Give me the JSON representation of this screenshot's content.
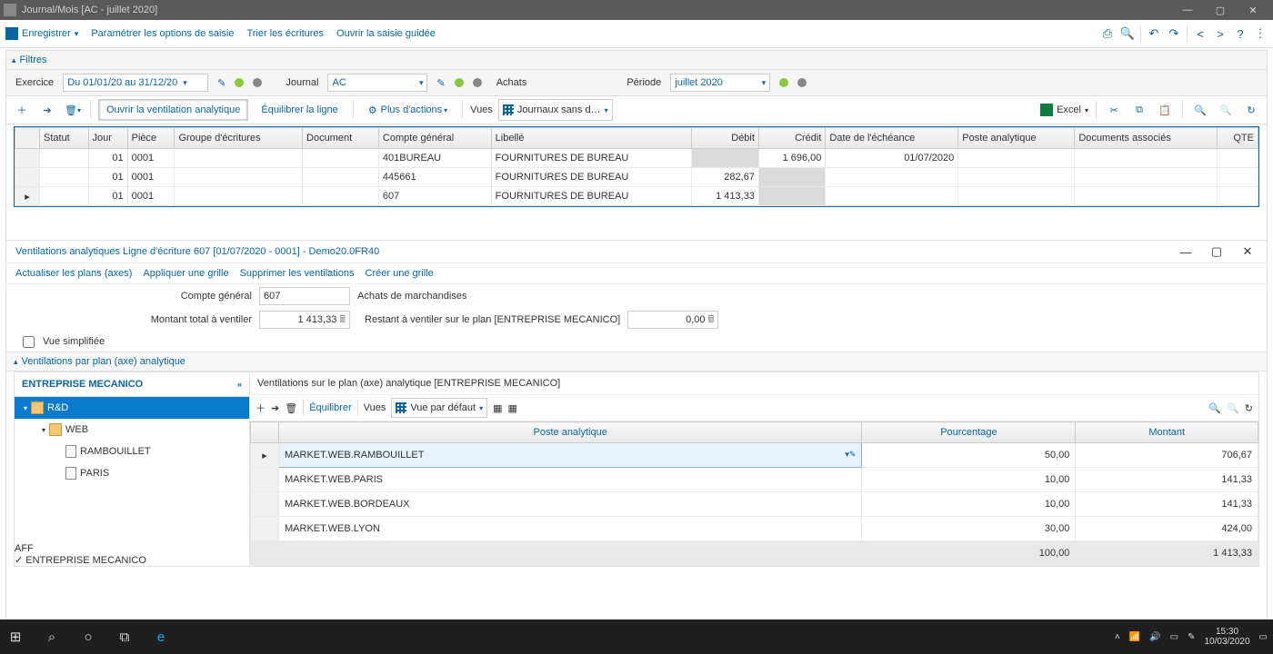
{
  "titlebar": {
    "title": "Journal/Mois [AC - juillet 2020]"
  },
  "toolbar1": {
    "save": "Enregistrer",
    "param": "Paramétrer les options de saisie",
    "trier": "Trier les écritures",
    "ouvrir": "Ouvrir la saisie guidée"
  },
  "filters": {
    "label": "Filtres"
  },
  "filterRow": {
    "exercice_lbl": "Exercice",
    "exercice_val": "Du 01/01/20 au 31/12/20",
    "journal_lbl": "Journal",
    "journal_val": "AC",
    "achats": "Achats",
    "periode_lbl": "Période",
    "periode_val": "juillet 2020"
  },
  "toolbar2": {
    "ouvrir_vent": "Ouvrir la ventilation analytique",
    "equilibrer": "Équilibrer la ligne",
    "plus": "Plus d'actions",
    "vues": "Vues",
    "vues_val": "Journaux sans d…",
    "excel": "Excel"
  },
  "grid1": {
    "cols": [
      "Statut",
      "Jour",
      "Pièce",
      "Groupe d'écritures",
      "Document",
      "Compte général",
      "Libellé",
      "Débit",
      "Crédit",
      "Date de l'échéance",
      "Poste analytique",
      "Documents associés",
      "QTE"
    ],
    "rows": [
      {
        "jour": "01",
        "piece": "0001",
        "compte": "401BUREAU",
        "libelle": "FOURNITURES DE BUREAU",
        "debit": "",
        "credit": "1 696,00",
        "echeance": "01/07/2020",
        "greyDebit": true
      },
      {
        "jour": "01",
        "piece": "0001",
        "compte": "445661",
        "libelle": "FOURNITURES DE BUREAU",
        "debit": "282,67",
        "credit": "",
        "greyCredit": true
      },
      {
        "jour": "01",
        "piece": "0001",
        "compte": "607",
        "libelle": "FOURNITURES DE BUREAU",
        "debit": "1 413,33",
        "credit": "",
        "greyCredit": true,
        "ptr": true
      }
    ]
  },
  "sub": {
    "title": "Ventilations analytiques Ligne d'écriture 607 [01/07/2020 - 0001] - Demo20.0FR40",
    "links": [
      "Actualiser les plans (axes)",
      "Appliquer une grille",
      "Supprimer les ventilations",
      "Créer une grille"
    ],
    "compte_lbl": "Compte général",
    "compte_val": "607",
    "compte_txt": "Achats de marchandises",
    "montant_lbl": "Montant total à ventiler",
    "montant_val": "1 413,33",
    "restant_lbl": "Restant à ventiler sur le plan [ENTREPRISE MECANICO]",
    "restant_val": "0,00",
    "vue_simpl": "Vue simplifiée",
    "section": "Ventilations par plan (axe) analytique"
  },
  "tree": {
    "title": "ENTREPRISE MECANICO",
    "rd": "R&D",
    "web": "WEB",
    "rambouillet": "RAMBOUILLET",
    "paris": "PARIS",
    "aff": "AFF",
    "ent": "ENTREPRISE MECANICO"
  },
  "rp": {
    "title": "Ventilations sur le plan (axe) analytique [ENTREPRISE MECANICO]",
    "equilibrer": "Équilibrer",
    "vues": "Vues",
    "vues_val": "Vue par défaut",
    "cols": [
      "Poste analytique",
      "Pourcentage",
      "Montant"
    ],
    "rows": [
      {
        "poste": "MARKET.WEB.RAMBOUILLET",
        "pct": "50,00",
        "montant": "706,67",
        "sel": true
      },
      {
        "poste": "MARKET.WEB.PARIS",
        "pct": "10,00",
        "montant": "141,33"
      },
      {
        "poste": "MARKET.WEB.BORDEAUX",
        "pct": "10,00",
        "montant": "141,33"
      },
      {
        "poste": "MARKET.WEB.LYON",
        "pct": "30,00",
        "montant": "424,00"
      }
    ],
    "footer": {
      "pct": "100,00",
      "montant": "1 413,33"
    }
  },
  "taskbar": {
    "time": "15:30",
    "date": "10/03/2020"
  }
}
